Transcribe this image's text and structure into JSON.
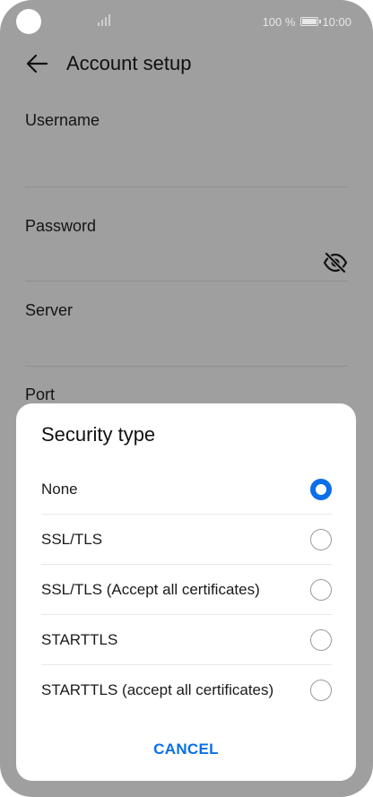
{
  "status_bar": {
    "battery_percent": "100 %",
    "time": "10:00",
    "icons": [
      "camera-dot",
      "signal-icon",
      "battery-icon"
    ]
  },
  "header": {
    "title": "Account setup",
    "back_icon": "back-arrow-icon"
  },
  "form": {
    "fields": [
      {
        "label": "Username",
        "value": ""
      },
      {
        "label": "Password",
        "value": "",
        "icon": "eye-slash-icon"
      },
      {
        "label": "Server",
        "value": ""
      },
      {
        "label": "Port",
        "value": ""
      }
    ]
  },
  "dialog": {
    "title": "Security type",
    "options": [
      {
        "label": "None",
        "selected": true
      },
      {
        "label": "SSL/TLS",
        "selected": false
      },
      {
        "label": "SSL/TLS (Accept all certificates)",
        "selected": false
      },
      {
        "label": "STARTTLS",
        "selected": false
      },
      {
        "label": "STARTTLS (accept all certificates)",
        "selected": false
      }
    ],
    "cancel_label": "CANCEL"
  },
  "colors": {
    "overlay": "#9f9f9f",
    "accent": "#0a6fe8",
    "dialog_bg": "#ffffff"
  }
}
